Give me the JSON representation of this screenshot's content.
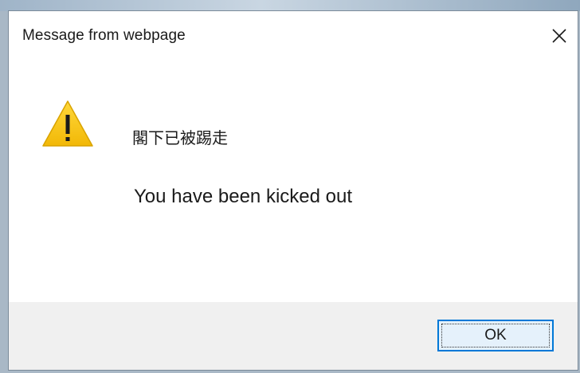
{
  "dialog": {
    "title": "Message from webpage",
    "icon": "warning-icon",
    "close_icon": "close-icon",
    "message_primary": "閣下已被踢走",
    "message_secondary": "You have been kicked out",
    "ok_label": "OK"
  },
  "colors": {
    "warning_yellow": "#f5c518",
    "focus_border": "#0078d7",
    "footer_bg": "#f0f0f0"
  }
}
